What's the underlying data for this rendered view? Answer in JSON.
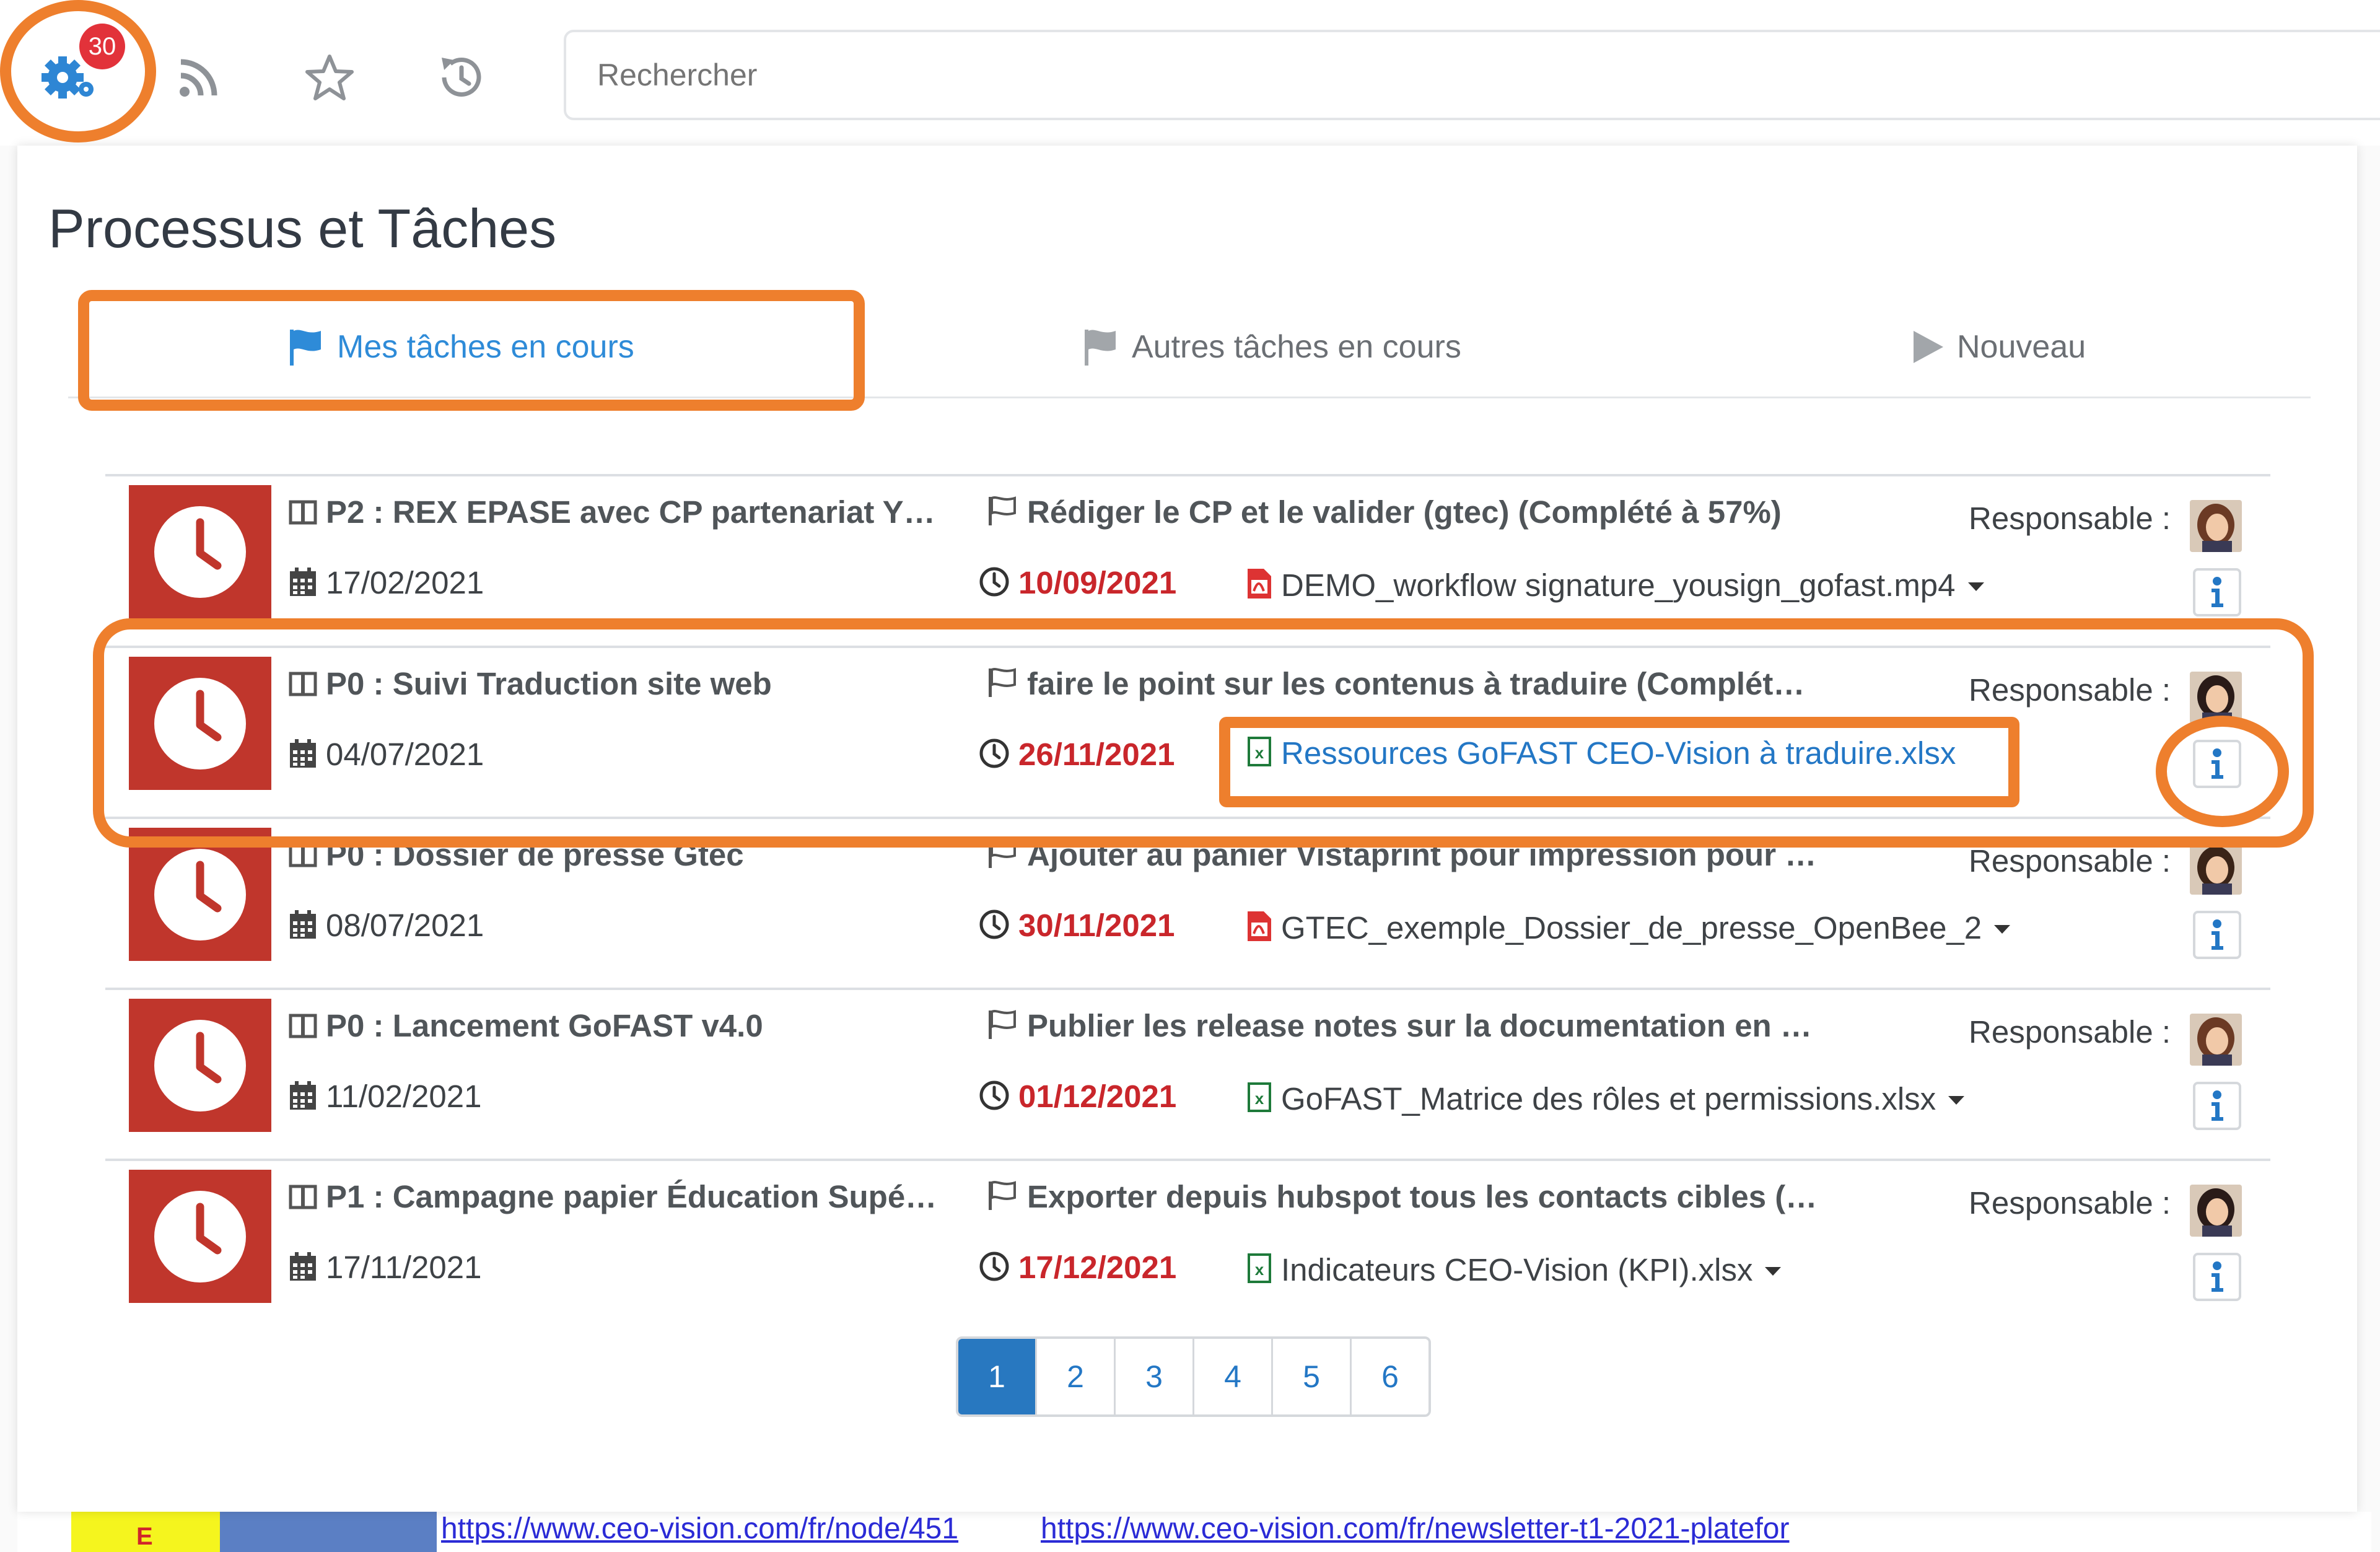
{
  "toolbar": {
    "badge_count": "30",
    "search_placeholder": "Rechercher"
  },
  "panel": {
    "title": "Processus et Tâches",
    "tabs": [
      {
        "label": "Mes tâches en cours",
        "active": true
      },
      {
        "label": "Autres tâches en cours",
        "active": false
      },
      {
        "label": "Nouveau",
        "active": false
      }
    ]
  },
  "tasks": [
    {
      "process": "P2 : REX EPASE avec CP partenariat Y…",
      "task": "Rédiger le CP et le valider (gtec) (Complété à 57%)",
      "responsable": "Responsable :",
      "start_date": "17/02/2021",
      "due_date": "10/09/2021",
      "file": "DEMO_workflow signature_yousign_gofast.mp4",
      "file_type": "pdf",
      "dropdown": true
    },
    {
      "process": "P0 : Suivi Traduction site web",
      "task": "faire le point sur les contenus à traduire (Complét…",
      "responsable": "Responsable :",
      "start_date": "04/07/2021",
      "due_date": "26/11/2021",
      "file": "Ressources GoFAST CEO-Vision à traduire.xlsx",
      "file_type": "excel",
      "dropdown": false
    },
    {
      "process": "P0 : Dossier de presse Gtec",
      "task": "Ajouter au panier Vistaprint pour impression pour …",
      "responsable": "Responsable :",
      "start_date": "08/07/2021",
      "due_date": "30/11/2021",
      "file": "GTEC_exemple_Dossier_de_presse_OpenBee_2",
      "file_type": "pdf",
      "dropdown": true
    },
    {
      "process": "P0 : Lancement GoFAST v4.0",
      "task": "Publier les release notes sur la documentation en …",
      "responsable": "Responsable :",
      "start_date": "11/02/2021",
      "due_date": "01/12/2021",
      "file": "GoFAST_Matrice des rôles et permissions.xlsx",
      "file_type": "excel",
      "dropdown": true
    },
    {
      "process": "P1 : Campagne papier Éducation Supé…",
      "task": "Exporter depuis hubspot tous les contacts cibles (…",
      "responsable": "Responsable :",
      "start_date": "17/11/2021",
      "due_date": "17/12/2021",
      "file": "Indicateurs CEO-Vision (KPI).xlsx",
      "file_type": "excel",
      "dropdown": true
    }
  ],
  "pagination": [
    "1",
    "2",
    "3",
    "4",
    "5",
    "6"
  ],
  "pagination_active": "1",
  "background": {
    "cell_e": "E",
    "link1": "https://www.ceo-vision.com/fr/node/451",
    "link2": "https://www.ceo-vision.com/fr/newsletter-t1-2021-platefor"
  },
  "colors": {
    "accent": "#2e8bd8",
    "danger": "#c0362c",
    "annotation": "#ee7f2d",
    "badge": "#e2323a"
  },
  "icons": {
    "toolbar": [
      "gears-icon",
      "rss-icon",
      "star-icon",
      "history-icon"
    ]
  }
}
